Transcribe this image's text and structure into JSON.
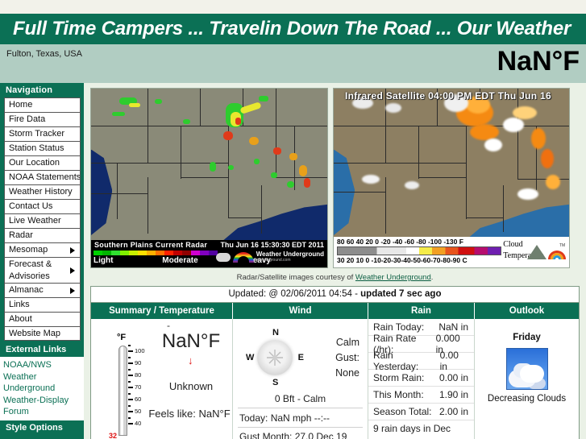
{
  "header": {
    "banner_title": "Full Time Campers ... Travelin Down The Road ... Our Weather",
    "location": "Fulton, Texas, USA",
    "current_temp": "NaN°F"
  },
  "sidebar": {
    "nav_header": "Navigation",
    "nav_items": [
      {
        "label": "Home",
        "submenu": false
      },
      {
        "label": "Fire Data",
        "submenu": false
      },
      {
        "label": "Storm Tracker",
        "submenu": false
      },
      {
        "label": "Station Status",
        "submenu": false
      },
      {
        "label": "Our Location",
        "submenu": false
      },
      {
        "label": "NOAA Statements",
        "submenu": false
      },
      {
        "label": "Weather History",
        "submenu": false
      },
      {
        "label": "Contact Us",
        "submenu": false
      },
      {
        "label": "Live Weather",
        "submenu": false
      },
      {
        "label": "Radar",
        "submenu": false
      },
      {
        "label": "Mesomap",
        "submenu": true
      },
      {
        "label": "Forecast & Advisories",
        "submenu": true
      },
      {
        "label": "Almanac",
        "submenu": true
      },
      {
        "label": "Links",
        "submenu": false
      },
      {
        "label": "About",
        "submenu": false
      },
      {
        "label": "Website Map",
        "submenu": false
      }
    ],
    "external_header": "External Links",
    "external_links": [
      "NOAA/NWS",
      "Weather Underground",
      "Weather-Display Forum"
    ],
    "style_header": "Style Options"
  },
  "maps": {
    "radar": {
      "title": "Southern Plains Current Radar",
      "timestamp": "Thu Jun 16 15:30:30 EDT 2011",
      "legend_light": "Light",
      "legend_moderate": "Moderate",
      "legend_heavy": "Heavy",
      "provider": "Weather Underground",
      "provider_sub": "wunderground.com"
    },
    "satellite": {
      "title": "Infrared Satellite 04:00 PM EDT Thu Jun 16",
      "scale_f": "80  60  40  20   0  -20 -40 -60 -80 -100  -130 F",
      "scale_c": "30 20 10  0 -10-20-30-40-50-60-70-80-90 C",
      "caption_line1": "Cloud",
      "caption_line2": "Temperature"
    },
    "courtesy_prefix": "Radar/Satellite images courtesy of ",
    "courtesy_link": "Weather Underground",
    "courtesy_suffix": "."
  },
  "table": {
    "updated_prefix": "Updated: @ 02/06/2011 04:54 - ",
    "updated_bold": "updated 7 sec ago",
    "headers": [
      "Summary / Temperature",
      "Wind",
      "Rain",
      "Outlook"
    ]
  },
  "temperature": {
    "dash": "-",
    "value": "NaN°F",
    "trend_arrow": "↓",
    "condition": "Unknown",
    "feels_like": "Feels like: NaN°F",
    "unit_label": "°F",
    "scale_ticks": [
      "100",
      "90",
      "80",
      "70",
      "60",
      "50",
      "40"
    ],
    "freeze_mark": "32"
  },
  "wind": {
    "compass_n": "N",
    "compass_s": "S",
    "compass_e": "E",
    "compass_w": "W",
    "speed": "Calm",
    "gust_label": "Gust:",
    "gust_value": "None",
    "beaufort": "0 Bft - Calm",
    "today": "Today: NaN mph --:--",
    "gust_month": "Gust Month: 27.0 Dec 19"
  },
  "rain": {
    "rows": [
      {
        "label": "Rain Today:",
        "value": "NaN in"
      },
      {
        "label": "Rain Rate (/hr):",
        "value": "0.000 in"
      },
      {
        "label": "Rain Yesterday:",
        "value": "0.00 in"
      },
      {
        "label": "Storm Rain:",
        "value": "0.00 in"
      },
      {
        "label": "This Month:",
        "value": "1.90 in"
      },
      {
        "label": "Season Total:",
        "value": "2.00 in"
      }
    ],
    "note": "9 rain days in Dec"
  },
  "outlook": {
    "day": "Friday",
    "description": "Decreasing Clouds"
  },
  "colors": {
    "brand_green": "#0b7055",
    "header_bar": "#b1cdc2",
    "content_bg": "#eaf1e6",
    "page_bg": "#f2f2ea"
  }
}
